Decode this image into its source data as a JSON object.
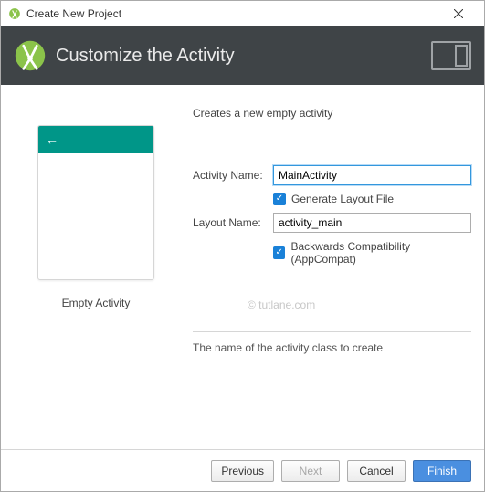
{
  "titlebar": {
    "title": "Create New Project"
  },
  "header": {
    "title": "Customize the Activity"
  },
  "desc": "Creates a new empty activity",
  "form": {
    "activity_name_label": "Activity Name:",
    "activity_name_value": "MainActivity",
    "generate_layout_label": "Generate Layout File",
    "layout_name_label": "Layout Name:",
    "layout_name_value": "activity_main",
    "compat_label": "Backwards Compatibility (AppCompat)"
  },
  "preview": {
    "label": "Empty Activity"
  },
  "watermark": "© tutlane.com",
  "helptext": "The name of the activity class to create",
  "footer": {
    "previous": "Previous",
    "next": "Next",
    "cancel": "Cancel",
    "finish": "Finish"
  }
}
